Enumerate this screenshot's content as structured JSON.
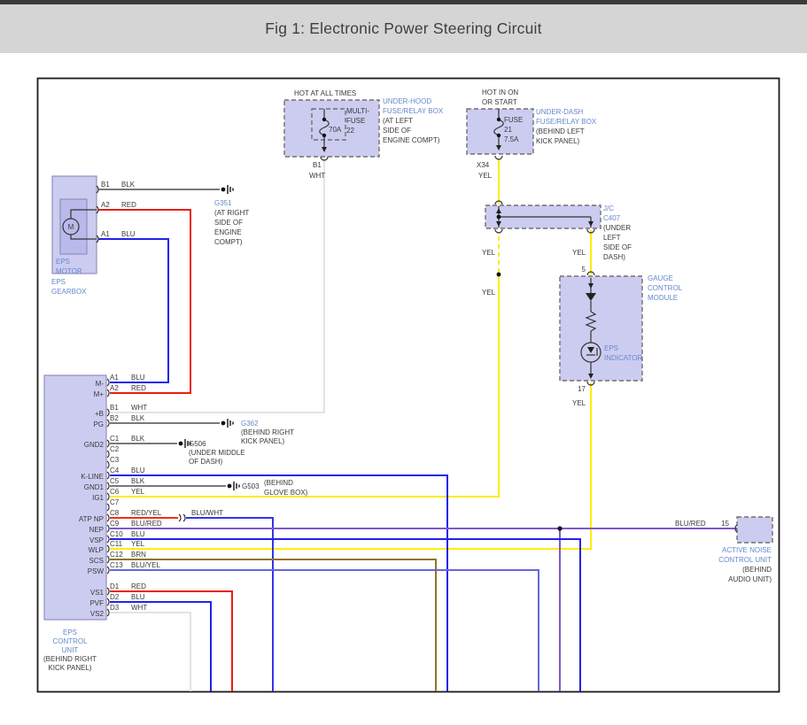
{
  "title": "Fig 1: Electronic Power Steering Circuit",
  "colors": {
    "blk": "#666666",
    "wht": "#e3e3e3",
    "red": "#e82010",
    "blu": "#2222ee",
    "yel": "#ffec00",
    "brn": "#8f7330",
    "blu_red": "#8055cc",
    "blu_wht": "#3535e5",
    "blu_yel": "#6666dd",
    "red_yel": "#ee3311",
    "label_blue": "#6688cc",
    "label_dark": "#3a3a3a",
    "box_fill": "#ccccf0",
    "motor_fill": "#b9b9ea",
    "box_border": "#8f8fbf",
    "dash_border": "#707070"
  },
  "under_hood": {
    "hot_label": "HOT AT ALL TIMES",
    "fuse_name_1": "MULTI-",
    "fuse_name_2": "FUSE",
    "fuse_name_3": "22",
    "amps": "70A",
    "pin": "B1",
    "wire": "WHT",
    "loc_lines": [
      "UNDER-HOOD",
      "FUSE/RELAY BOX",
      "(AT LEFT",
      "SIDE OF",
      "ENGINE COMPT)"
    ]
  },
  "under_dash": {
    "hot_line_1": "HOT IN ON",
    "hot_line_2": "OR START",
    "fuse_name": "FUSE",
    "fuse_num": "21",
    "amps": "7.5A",
    "pin": "X34",
    "wire": "YEL",
    "loc_lines": [
      "UNDER-DASH",
      "FUSE/RELAY BOX",
      "(BEHIND LEFT",
      "KICK PANEL)"
    ]
  },
  "gearbox": {
    "label_1": "EPS",
    "label_2": "GEARBOX",
    "motor_label_1": "EPS",
    "motor_label_2": "MOTOR",
    "motor_m": "M",
    "pins": [
      {
        "pin": "B1",
        "wire": "BLK"
      },
      {
        "pin": "A2",
        "wire": "RED"
      },
      {
        "pin": "A1",
        "wire": "BLU"
      }
    ]
  },
  "grounds": {
    "g351": [
      "G351",
      "(AT RIGHT",
      "SIDE OF",
      "ENGINE",
      "COMPT)"
    ],
    "g362": [
      "G362",
      "(BEHIND RIGHT",
      "KICK PANEL)"
    ],
    "g506": [
      "G506",
      "(UNDER MIDDLE",
      "OF DASH)"
    ],
    "g503": [
      "G503",
      "(BEHIND",
      "GLOVE BOX)"
    ]
  },
  "jc": {
    "loc_lines": [
      "J/C",
      "C407",
      "(UNDER",
      "LEFT",
      "SIDE OF",
      "DASH)"
    ],
    "yel_top": "YEL",
    "yel_mid": "YEL",
    "yel_right": "YEL"
  },
  "gauge": {
    "name_lines": [
      "GAUGE",
      "CONTROL",
      "MODULE"
    ],
    "pin_top": "5",
    "pin_bottom": "17",
    "indicator_1": "EPS",
    "indicator_2": "INDICATOR",
    "wire_below": "YEL"
  },
  "anc": {
    "wire": "BLU/RED",
    "pin": "15",
    "name_lines": [
      "ACTIVE NOISE",
      "CONTROL UNIT",
      "(BEHIND",
      "AUDIO UNIT)"
    ]
  },
  "eps_unit": {
    "name_lines": [
      "EPS",
      "CONTROL",
      "UNIT",
      "(BEHIND RIGHT",
      "KICK PANEL)"
    ],
    "c8_wire2": "BLU/WHT",
    "rows": [
      {
        "name": "M-",
        "pin": "A1",
        "wire": "BLU"
      },
      {
        "name": "M+",
        "pin": "A2",
        "wire": "RED"
      },
      {
        "name": "+B",
        "pin": "B1",
        "wire": "WHT"
      },
      {
        "name": "PG",
        "pin": "B2",
        "wire": "BLK"
      },
      {
        "name": "GND2",
        "pin": "C1",
        "wire": "BLK"
      },
      {
        "name": "",
        "pin": "C2",
        "wire": ""
      },
      {
        "name": "",
        "pin": "C3",
        "wire": ""
      },
      {
        "name": "K-LINE",
        "pin": "C4",
        "wire": "BLU"
      },
      {
        "name": "GND1",
        "pin": "C5",
        "wire": "BLK"
      },
      {
        "name": "IG1",
        "pin": "C6",
        "wire": "YEL"
      },
      {
        "name": "",
        "pin": "C7",
        "wire": ""
      },
      {
        "name": "ATP NP",
        "pin": "C8",
        "wire": "RED/YEL"
      },
      {
        "name": "NEP",
        "pin": "C9",
        "wire": "BLU/RED"
      },
      {
        "name": "VSP",
        "pin": "C10",
        "wire": "BLU"
      },
      {
        "name": "WLP",
        "pin": "C11",
        "wire": "YEL"
      },
      {
        "name": "SCS",
        "pin": "C12",
        "wire": "BRN"
      },
      {
        "name": "PSW",
        "pin": "C13",
        "wire": "BLU/YEL"
      },
      {
        "name": "VS1",
        "pin": "D1",
        "wire": "RED"
      },
      {
        "name": "PVF",
        "pin": "D2",
        "wire": "BLU"
      },
      {
        "name": "VS2",
        "pin": "D3",
        "wire": "WHT"
      }
    ]
  },
  "anc_wire_label": "BLU/RED"
}
